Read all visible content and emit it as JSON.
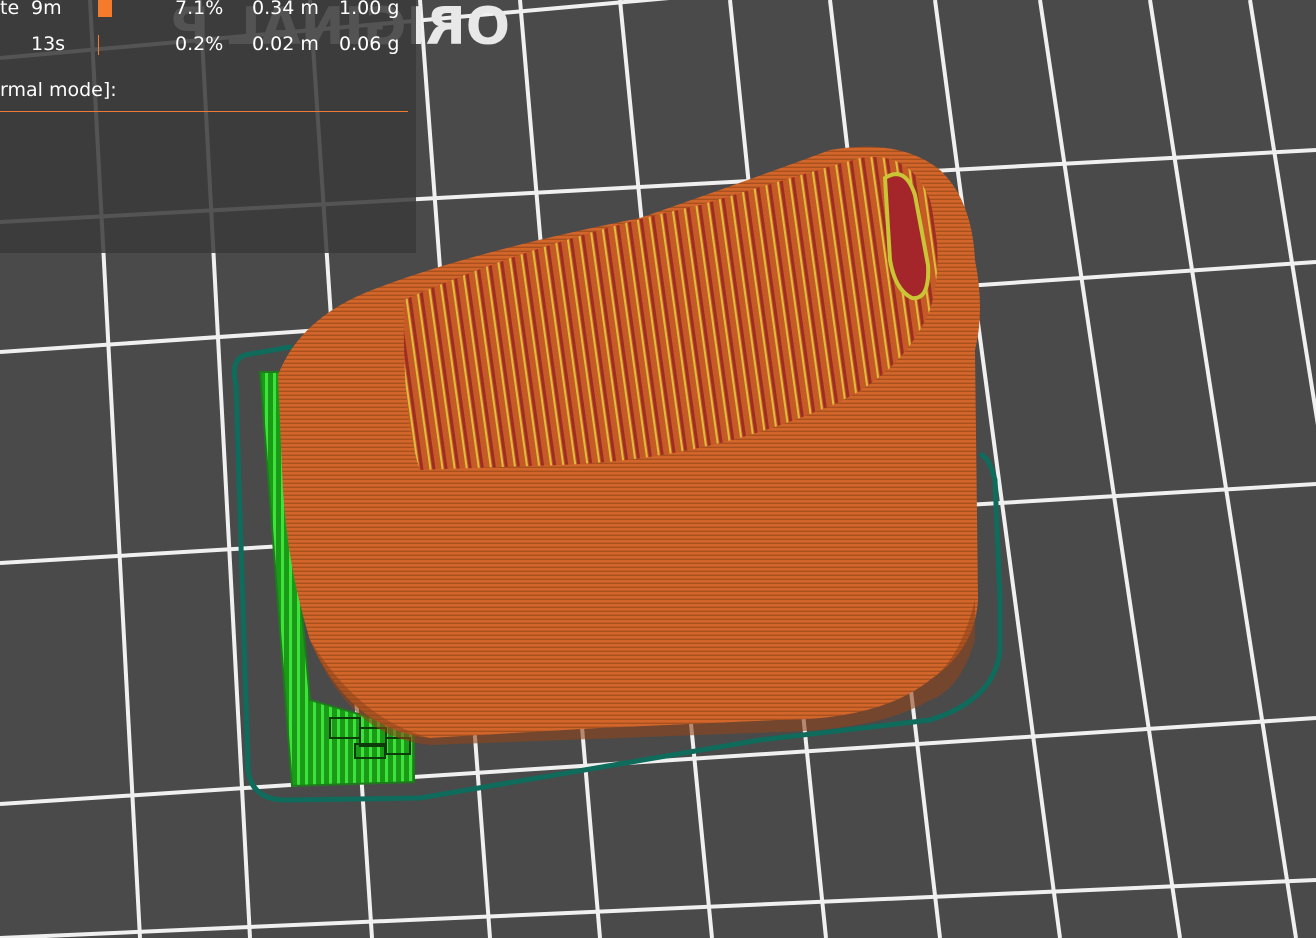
{
  "bed_logo": {
    "text": "ORIGINAL P",
    "color": "#e8e8e8"
  },
  "legend": {
    "rows": [
      {
        "feature": "te",
        "time": "9m",
        "percent": "7.1%",
        "length": "0.34 m",
        "weight": "1.00 g",
        "swatch": "solid"
      },
      {
        "feature": "",
        "time": "13s",
        "percent": "0.2%",
        "length": "0.02 m",
        "weight": "0.06 g",
        "swatch": "line"
      }
    ],
    "section_title": "rmal mode]:",
    "accent_color": "#ee7a33"
  },
  "model": {
    "perimeter_color": "#d9692a",
    "infill_color": "#a5262a",
    "top_solid_color": "#c9c534",
    "support_color": "#2ed12a",
    "skirt_color": "#0f6b5b"
  },
  "bed": {
    "background": "#4a4a4a",
    "grid_color": "#ffffff"
  }
}
